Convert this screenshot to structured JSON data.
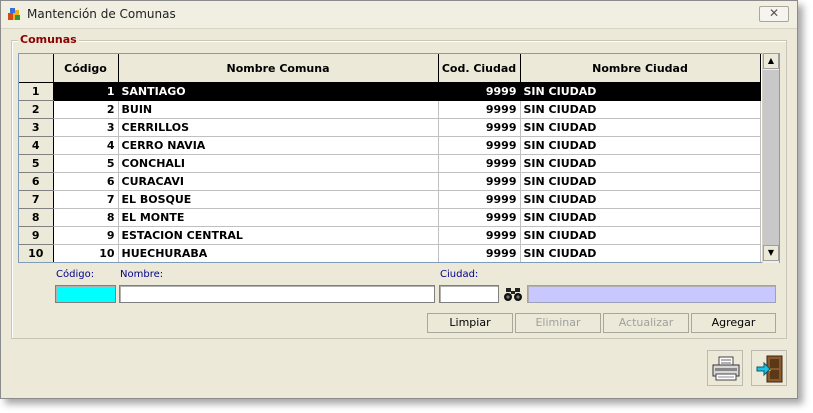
{
  "window": {
    "title": "Mantención de Comunas",
    "close_symbol": "✕"
  },
  "group": {
    "label": "Comunas"
  },
  "grid": {
    "columns": [
      "",
      "Código",
      "Nombre Comuna",
      "Cod. Ciudad",
      "Nombre Ciudad"
    ],
    "rows": [
      {
        "row": "1",
        "codigo": "1",
        "nombre": "SANTIAGO",
        "cod_ciudad": "9999",
        "nombre_ciudad": "SIN CIUDAD"
      },
      {
        "row": "2",
        "codigo": "2",
        "nombre": "BUIN",
        "cod_ciudad": "9999",
        "nombre_ciudad": "SIN CIUDAD"
      },
      {
        "row": "3",
        "codigo": "3",
        "nombre": "CERRILLOS",
        "cod_ciudad": "9999",
        "nombre_ciudad": "SIN CIUDAD"
      },
      {
        "row": "4",
        "codigo": "4",
        "nombre": "CERRO NAVIA",
        "cod_ciudad": "9999",
        "nombre_ciudad": "SIN CIUDAD"
      },
      {
        "row": "5",
        "codigo": "5",
        "nombre": "CONCHALI",
        "cod_ciudad": "9999",
        "nombre_ciudad": "SIN CIUDAD"
      },
      {
        "row": "6",
        "codigo": "6",
        "nombre": "CURACAVI",
        "cod_ciudad": "9999",
        "nombre_ciudad": "SIN CIUDAD"
      },
      {
        "row": "7",
        "codigo": "7",
        "nombre": "EL BOSQUE",
        "cod_ciudad": "9999",
        "nombre_ciudad": "SIN CIUDAD"
      },
      {
        "row": "8",
        "codigo": "8",
        "nombre": "EL MONTE",
        "cod_ciudad": "9999",
        "nombre_ciudad": "SIN CIUDAD"
      },
      {
        "row": "9",
        "codigo": "9",
        "nombre": "ESTACION CENTRAL",
        "cod_ciudad": "9999",
        "nombre_ciudad": "SIN CIUDAD"
      },
      {
        "row": "10",
        "codigo": "10",
        "nombre": "HUECHURABA",
        "cod_ciudad": "9999",
        "nombre_ciudad": "SIN CIUDAD"
      }
    ],
    "selected_row": 0
  },
  "scrollbar": {
    "up_symbol": "▲",
    "down_symbol": "▼"
  },
  "form": {
    "codigo_label": "Código:",
    "nombre_label": "Nombre:",
    "ciudad_label": "Ciudad:",
    "codigo_value": "",
    "nombre_value": "",
    "ciudad_value": "",
    "ciudad_nombre_value": "",
    "codigo_color": "#00ffff",
    "ciudad_nombre_color": "#c8c8ff"
  },
  "buttons": {
    "limpiar": "Limpiar",
    "eliminar": "Eliminar",
    "actualizar": "Actualizar",
    "agregar": "Agregar"
  },
  "icons": {
    "app": "app-icon",
    "binoculars": "binoculars-icon",
    "print": "printer-icon",
    "exit": "exit-door-icon"
  }
}
